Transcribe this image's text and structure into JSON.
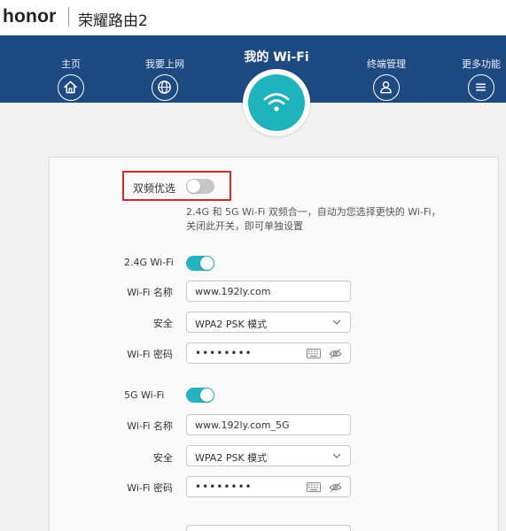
{
  "header": {
    "logo": "honor",
    "app_title": "荣耀路由2"
  },
  "nav": {
    "items": [
      {
        "label": "主页",
        "icon": "home-icon"
      },
      {
        "label": "我要上网",
        "icon": "globe-icon"
      },
      {
        "label": "我的 Wi-Fi",
        "icon": "wifi-icon",
        "active": true
      },
      {
        "label": "终端管理",
        "icon": "user-icon"
      },
      {
        "label": "更多功能",
        "icon": "menu-icon"
      }
    ]
  },
  "dual_band": {
    "label": "双频优选",
    "enabled": false,
    "description": "2.4G 和 5G Wi-Fi 双频合一，自动为您选择更快的 Wi-Fi，关闭此开关，即可单独设置"
  },
  "wifi_24g": {
    "label": "2.4G Wi-Fi",
    "enabled": true,
    "name_label": "Wi-Fi 名称",
    "name_value": "www.192ly.com",
    "security_label": "安全",
    "security_value": "WPA2 PSK 模式",
    "password_label": "Wi-Fi 密码",
    "password_value": "••••••••"
  },
  "wifi_5g": {
    "label": "5G Wi-Fi",
    "enabled": true,
    "name_label": "Wi-Fi 名称",
    "name_value": "www.192ly.com_5G",
    "security_label": "安全",
    "security_value": "WPA2 PSK 模式",
    "password_label": "Wi-Fi 密码",
    "password_value": "••••••••"
  },
  "colors": {
    "nav_bg": "#1e4a82",
    "accent": "#1fb3bd",
    "toggle_on": "#27b2c2",
    "highlight": "#d9262a"
  }
}
